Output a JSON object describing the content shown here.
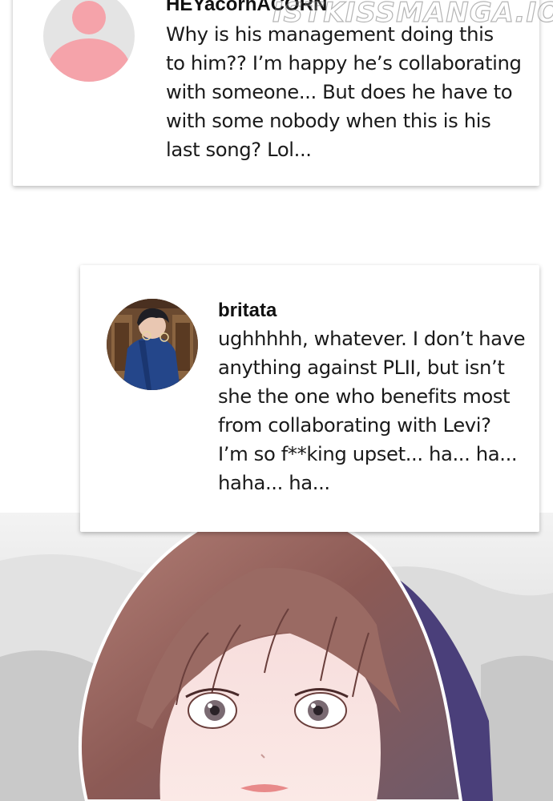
{
  "watermark": "ISTKISSMANGA.IO",
  "comments": [
    {
      "username": "HEYacornACORN",
      "text": "Why is his management doing this\nto him?? I’m happy he’s collaborating\nwith someone...  But does he have to\nwith some nobody when this is his\nlast song? Lol...",
      "avatar": "default-user-icon"
    },
    {
      "username": "britata",
      "text": "ughhhhh, whatever. I don’t have\nanything against PLII, but isn’t\nshe the one who benefits most\nfrom collaborating with Levi?\nI’m so f**king upset... ha... ha...\nhaha... ha...",
      "avatar": "profile-photo"
    }
  ],
  "colors": {
    "avatar_pink": "#f5a3aa",
    "hair": "#8a5a52",
    "background_snow": "#dcdcdc"
  }
}
